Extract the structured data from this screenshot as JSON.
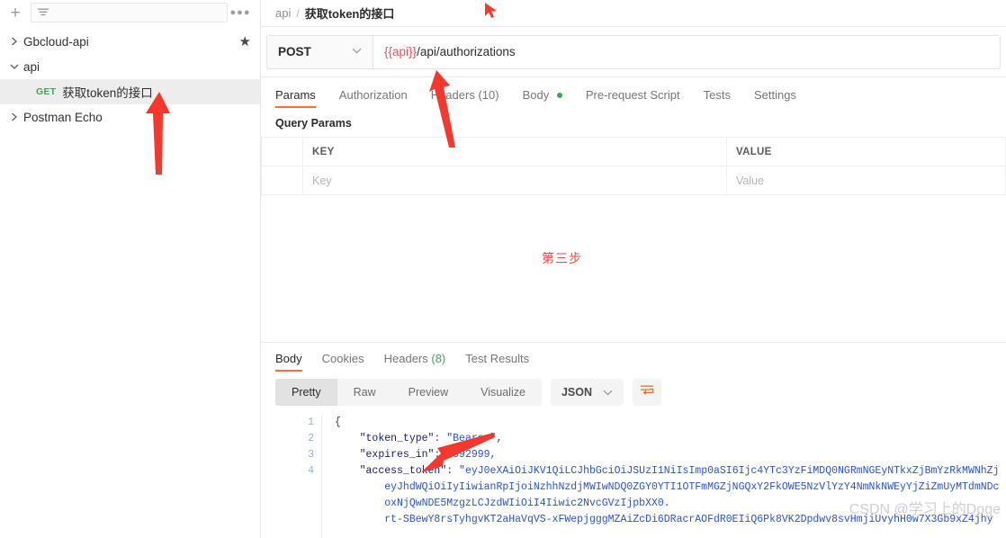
{
  "sidebar": {
    "toolbar": {
      "add_label": "+",
      "filter_icon": "filter-icon",
      "more_label": "●●●",
      "search_placeholder": ""
    },
    "tree": [
      {
        "label": "Gbcloud-api",
        "expanded": false,
        "starred": true,
        "twisty": "›"
      },
      {
        "label": "api",
        "expanded": true,
        "starred": false,
        "twisty": "⌄"
      },
      {
        "label": "获取token的接口",
        "method": "GET",
        "selected": true,
        "type": "request"
      },
      {
        "label": "Postman Echo",
        "expanded": false,
        "starred": false,
        "twisty": "›"
      }
    ]
  },
  "breadcrumb": {
    "collection": "api",
    "separator": "/",
    "request_name": "获取token的接口"
  },
  "url_bar": {
    "method": "POST",
    "caret": "⌄",
    "url_variable": "{{api}}",
    "url_path": "/api/authorizations"
  },
  "request_tabs": [
    {
      "label": "Params",
      "active": true
    },
    {
      "label": "Authorization",
      "active": false
    },
    {
      "label": "Headers",
      "count": "(10)",
      "active": false
    },
    {
      "label": "Body",
      "active": false,
      "dot": true
    },
    {
      "label": "Pre-request Script",
      "active": false
    },
    {
      "label": "Tests",
      "active": false
    },
    {
      "label": "Settings",
      "active": false
    }
  ],
  "query_params": {
    "title": "Query Params",
    "headers": [
      "KEY",
      "VALUE"
    ],
    "rows": [
      {
        "key": "Key",
        "value": "Value"
      }
    ]
  },
  "annotations": {
    "step_note": "第三步",
    "arrow_color": "#f4382d",
    "cursor_color": "#f4382d"
  },
  "response": {
    "tabs": [
      {
        "label": "Body",
        "active": true
      },
      {
        "label": "Cookies",
        "active": false
      },
      {
        "label": "Headers",
        "count": "(8)",
        "active": false
      },
      {
        "label": "Test Results",
        "active": false
      }
    ],
    "view_modes": [
      {
        "label": "Pretty",
        "active": true
      },
      {
        "label": "Raw",
        "active": false
      },
      {
        "label": "Preview",
        "active": false
      },
      {
        "label": "Visualize",
        "active": false
      }
    ],
    "format": "JSON",
    "format_caret": "⌄",
    "wrap_icon": "wrap-lines-icon",
    "line_numbers": [
      "1",
      "2",
      "3",
      "4"
    ],
    "body": {
      "line1": "{",
      "line2_key": "\"token_type\"",
      "line2_val": "\"Bearer\"",
      "line3_key": "\"expires_in\"",
      "line3_val": "2592999,",
      "line4_key": "\"access_token\"",
      "line4_val": "\"eyJ0eXAiOiJKV1QiLCJhbGciOiJSUzI1NiIsImp0aSI6Ijc4YTc3YzFiMDQ0NGRmNGEyNTkxZjBmYzRkMWNhZj",
      "line5": "eyJhdWQiOiIyIiwianRpIjoiNzhhNzdjMWIwNDQ0ZGY0YTI1OTFmMGZjNGQxY2FkOWE5NzVlYzY4NmNkNWEyYjZiZmUyMTdmNDc",
      "line6": "oxNjQwNDE5MzgzLCJzdWIiOiI4Iiwic2NvcGVzIjpbXX0.",
      "line7": "rt-SBewY8rsTyhgvKT2aHaVqVS-xFWepjgggMZAiZcDi6DRacrAOFdR0EIiQ6Pk8VK2Dpdwv8svHmjiUvyhH0w7X3Gb9xZ4jhy"
    }
  },
  "watermark": "CSDN @学习上的Doge"
}
